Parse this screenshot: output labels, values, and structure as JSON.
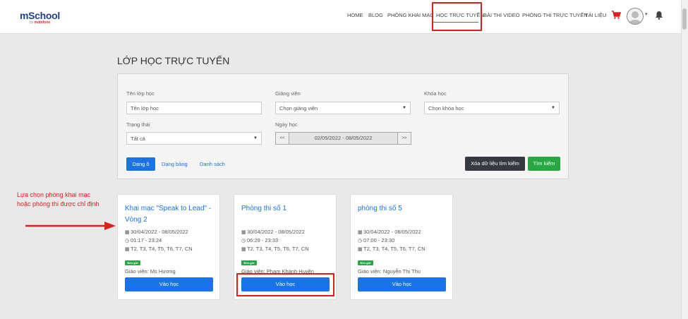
{
  "header": {
    "logo_main": "mSchool",
    "logo_sub_prefix": "by",
    "logo_sub_brand": "mobifone",
    "nav": [
      "HOME",
      "BLOG",
      "PHÒNG KHAI MẠC",
      "HỌC TRỰC TUYẾN",
      "BÀI THI VIDEO",
      "PHÒNG THI TRỰC TUYẾN",
      "TÀI LIỆU"
    ],
    "active_nav": "HỌC TRỰC TUYẾN"
  },
  "page": {
    "title": "LỚP HỌC TRỰC TUYẾN"
  },
  "search": {
    "class_name_label": "Tên lớp học",
    "class_name_placeholder": "Tên lớp học",
    "teacher_label": "Giảng viên",
    "teacher_value": "Chọn giảng viên",
    "course_label": "Khóa học",
    "course_value": "Chọn khóa học",
    "status_label": "Trạng thái",
    "status_value": "Tất cả",
    "date_label": "Ngày học",
    "date_prev": "<<",
    "date_range": "02/05/2022 - 08/05/2022",
    "date_next": ">>",
    "view_tile": "Dạng ô",
    "view_board": "Dạng bảng",
    "view_list": "Danh sách",
    "clear_label": "Xóa dữ liệu tìm kiếm",
    "search_label": "Tìm kiếm"
  },
  "annotation": {
    "line1": "Lựa chọn phòng khai mạc",
    "line2": "hoặc phòng thi được chỉ định"
  },
  "cards": [
    {
      "title": "Khai mạc \"Speak to Lead\" - Vòng 2",
      "dates": "30/04/2022 - 08/05/2022",
      "time": "01:17 - 23:24",
      "days": "T2, T3, T4, T5, T6, T7, CN",
      "badge": "Đến giờ",
      "teacher": "Giáo viên: Ms Hương",
      "button": "Vào học"
    },
    {
      "title": "Phòng thi số 1",
      "dates": "30/04/2022 - 08/05/2022",
      "time": "06:29 - 23:33",
      "days": "T2, T3, T4, T5, T6, T7, CN",
      "badge": "Đến giờ",
      "teacher": "Giáo viên: Phạm Khánh Huyền",
      "button": "Vào học"
    },
    {
      "title": "phòng thi số 5",
      "dates": "30/04/2022 - 08/05/2022",
      "time": "07:00 - 23:30",
      "days": "T2, T3, T4, T5, T6, T7, CN",
      "badge": "Đến giờ",
      "teacher": "Giáo viên: Nguyễn Thị Thu",
      "button": "Vào học"
    }
  ],
  "colors": {
    "primary": "#1a73e8",
    "success": "#28a745",
    "dark": "#343a40",
    "highlight": "#e21d1d",
    "logo": "#1f3f8f"
  },
  "icons": {
    "calendar": "calendar-icon",
    "clock": "clock-icon",
    "days": "calendar-days-icon",
    "cart": "cart-icon",
    "bell": "bell-icon",
    "avatar": "user-avatar-icon"
  }
}
